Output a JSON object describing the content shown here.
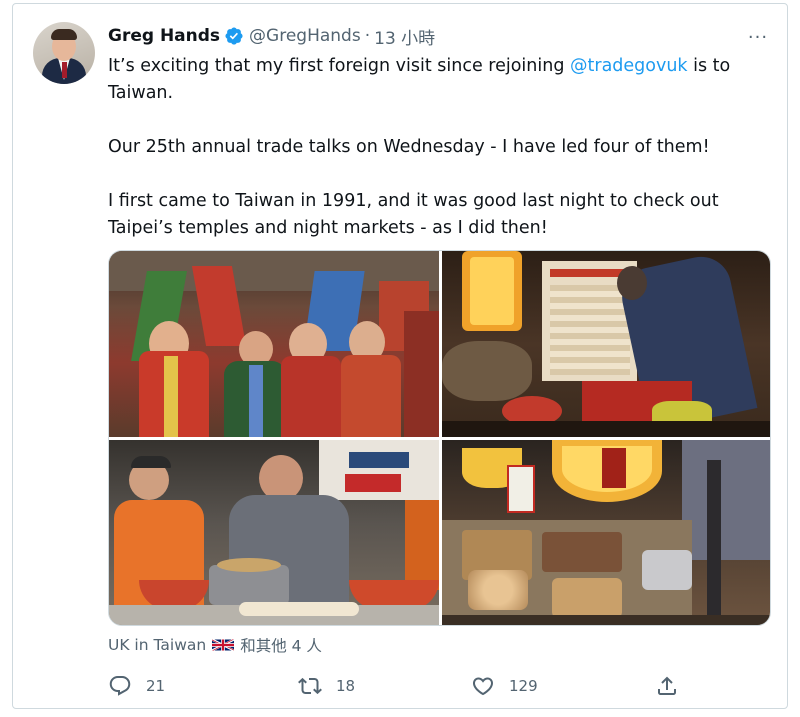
{
  "tweet": {
    "author_name": "Greg Hands",
    "author_handle": "@GregHands",
    "separator": "·",
    "timestamp": "13 小時",
    "more_label": "···",
    "line1_before": "It’s exciting that my first foreign visit since rejoining ",
    "mention": "@tradegovuk",
    "line1_after": " is to",
    "line2": "Taiwan.",
    "line3": "Our 25th annual trade talks on Wednesday - I have led four of them!",
    "line4": "I first came to Taiwan in 1991, and it was good last night to check out",
    "line5": "Taipei’s temples and night markets - as I did then!"
  },
  "tagged": {
    "account": "UK in Taiwan",
    "others": "和其他 4 人"
  },
  "actions": {
    "replies": "21",
    "retweets": "18",
    "likes": "129"
  },
  "colors": {
    "accent": "#1d9bf0",
    "secondary_text": "#536471",
    "border": "#cfd9de"
  },
  "icons": [
    "verified-badge-icon",
    "more-icon",
    "uk-flag-icon",
    "reply-icon",
    "retweet-icon",
    "like-icon",
    "share-icon"
  ]
}
